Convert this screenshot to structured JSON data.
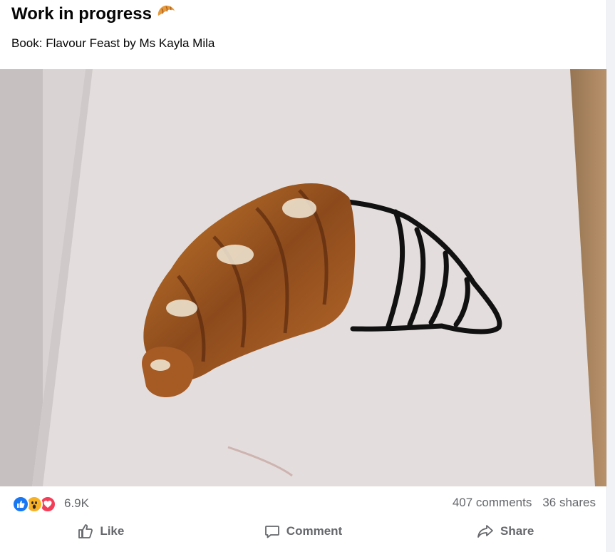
{
  "post": {
    "title": "Work in progress",
    "title_emoji": "croissant-emoji",
    "subtitle": "Book: Flavour Feast by Ms Kayla Mila"
  },
  "photo": {
    "alt_icon": "croissant-illustration"
  },
  "reactions": {
    "icons": [
      "like-reaction-icon",
      "wow-reaction-icon",
      "love-reaction-icon"
    ],
    "count": "6.9K",
    "comments": "407 comments",
    "shares": "36 shares"
  },
  "actions": {
    "like": "Like",
    "comment": "Comment",
    "share": "Share"
  },
  "colors": {
    "like_blue": "#1877f2",
    "love_red": "#f33e58",
    "wow_yellow": "#f7b125",
    "secondary_text": "#65676b"
  }
}
